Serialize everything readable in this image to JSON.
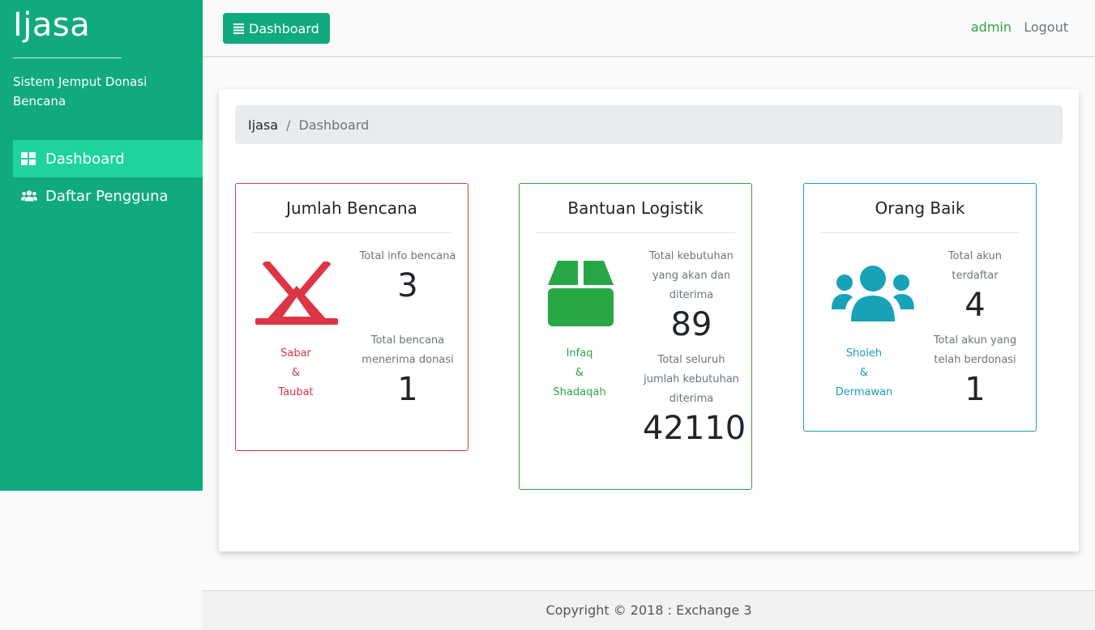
{
  "sidebar": {
    "brand": "Ijasa",
    "tagline": "Sistem Jemput Donasi Bencana",
    "items": [
      {
        "label": "Dashboard",
        "icon": "grid-icon",
        "active": true
      },
      {
        "label": "Daftar Pengguna",
        "icon": "users-icon",
        "active": false
      }
    ]
  },
  "topbar": {
    "toggle_label": "Dashboard",
    "user": "admin",
    "logout": "Logout"
  },
  "breadcrumb": {
    "home": "Ijasa",
    "separator": "/",
    "current": "Dashboard"
  },
  "cards": [
    {
      "title": "Jumlah Bencana",
      "icon": "campground-icon",
      "color": "#dc3545",
      "motto": [
        "Sabar",
        "&",
        "Taubat"
      ],
      "stats": [
        {
          "label": "Total info bencana",
          "value": "3"
        },
        {
          "label": "Total bencana menerima donasi",
          "value": "1"
        }
      ]
    },
    {
      "title": "Bantuan Logistik",
      "icon": "box-icon",
      "color": "#28a745",
      "motto": [
        "Infaq",
        "&",
        "Shadaqah"
      ],
      "stats": [
        {
          "label": "Total kebutuhan yang akan dan diterima",
          "value": "89"
        },
        {
          "label": "Total seluruh jumlah kebutuhan diterima",
          "value": "42110"
        }
      ]
    },
    {
      "title": "Orang Baik",
      "icon": "users-icon",
      "color": "#17a2b8",
      "motto": [
        "Sholeh",
        "&",
        "Dermawan"
      ],
      "stats": [
        {
          "label": "Total akun terdaftar",
          "value": "4"
        },
        {
          "label": "Total akun yang telah berdonasi",
          "value": "1"
        }
      ]
    }
  ],
  "footer": "Copyright © 2018 : Exchange 3",
  "colors": {
    "sidebar_bg": "#11aa7f",
    "sidebar_active": "#1fd39f",
    "red": "#dc3545",
    "green": "#28a745",
    "teal": "#17a2b8"
  }
}
